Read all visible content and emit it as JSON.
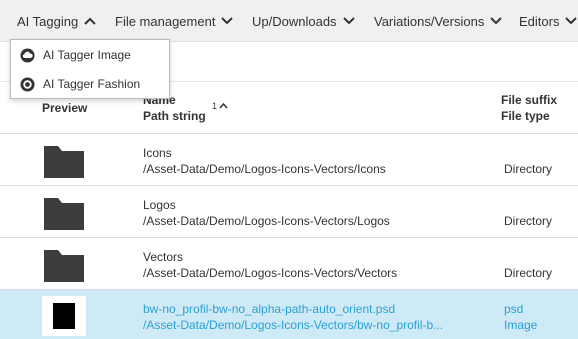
{
  "toolbar": {
    "items": [
      {
        "label": "AI Tagging",
        "state": "open"
      },
      {
        "label": "File management"
      },
      {
        "label": "Up/Downloads"
      },
      {
        "label": "Variations/Versions"
      },
      {
        "label": "Editors"
      }
    ]
  },
  "dropdown": {
    "items": [
      {
        "label": "AI Tagger Image",
        "icon": "cloud-icon"
      },
      {
        "label": "AI Tagger Fashion",
        "icon": "target-icon"
      }
    ]
  },
  "table": {
    "headers": {
      "preview": "Preview",
      "name": "Name",
      "path": "Path string",
      "sort_index": "1",
      "suffix": "File suffix",
      "type": "File type"
    },
    "rows": [
      {
        "name": "Icons",
        "path": "/Asset-Data/Demo/Logos-Icons-Vectors/Icons",
        "suffix": "",
        "type": "Directory",
        "preview": "folder-icon",
        "selected": false
      },
      {
        "name": "Logos",
        "path": "/Asset-Data/Demo/Logos-Icons-Vectors/Logos",
        "suffix": "",
        "type": "Directory",
        "preview": "folder-icon",
        "selected": false
      },
      {
        "name": "Vectors",
        "path": "/Asset-Data/Demo/Logos-Icons-Vectors/Vectors",
        "suffix": "",
        "type": "Directory",
        "preview": "folder-icon",
        "selected": false
      },
      {
        "name": "bw-no_profil-bw-no_alpha-path-auto_orient.psd",
        "path": "/Asset-Data/Demo/Logos-Icons-Vectors/bw-no_profil-b...",
        "suffix": "psd",
        "type": "Image",
        "preview": "image-thumbnail",
        "selected": true
      }
    ]
  },
  "colors": {
    "toolbar_bg": "#f0f0f0",
    "selected_row_bg": "#cfeaf7",
    "selected_text": "#2aa0d4",
    "folder": "#3d3d3d"
  }
}
